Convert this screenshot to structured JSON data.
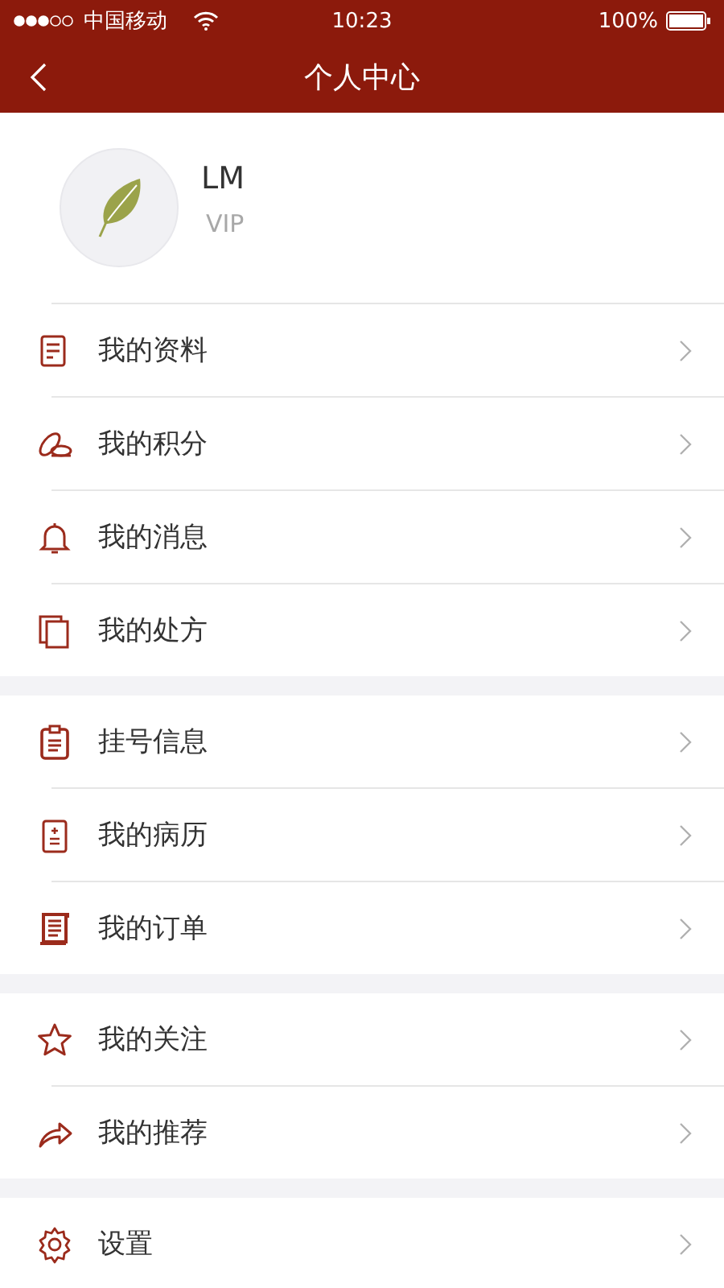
{
  "status_bar": {
    "carrier": "中国移动",
    "time": "10:23",
    "battery": "100%"
  },
  "nav": {
    "title": "个人中心"
  },
  "profile": {
    "name": "LM",
    "level": "VIP"
  },
  "groups": [
    {
      "items": [
        {
          "label": "我的资料"
        },
        {
          "label": "我的积分"
        },
        {
          "label": "我的消息"
        },
        {
          "label": "我的处方"
        }
      ]
    },
    {
      "items": [
        {
          "label": "挂号信息"
        },
        {
          "label": "我的病历"
        },
        {
          "label": "我的订单"
        }
      ]
    },
    {
      "items": [
        {
          "label": "我的关注"
        },
        {
          "label": "我的推荐"
        }
      ]
    },
    {
      "items": [
        {
          "label": "设置"
        }
      ]
    }
  ]
}
